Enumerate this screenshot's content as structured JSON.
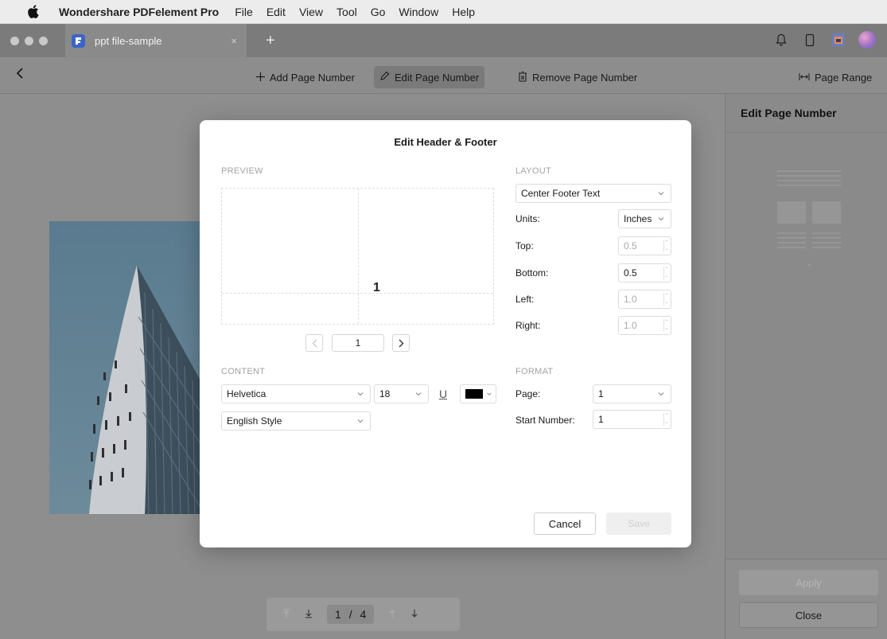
{
  "menubar": {
    "app_name": "Wondershare PDFelement Pro",
    "items": [
      "File",
      "Edit",
      "View",
      "Tool",
      "Go",
      "Window",
      "Help"
    ]
  },
  "tabbar": {
    "tab_title": "ppt file-sample",
    "close_glyph": "×",
    "add_glyph": "+"
  },
  "toolbar": {
    "add_page_number": "Add Page Number",
    "edit_page_number": "Edit Page Number",
    "remove_page_number": "Remove Page Number",
    "page_range": "Page Range"
  },
  "page_nav": {
    "current": "1",
    "separator": "/",
    "total": "4"
  },
  "right_panel": {
    "title": "Edit Page Number",
    "apply": "Apply",
    "close": "Close"
  },
  "dialog": {
    "title": "Edit Header & Footer",
    "preview_label": "PREVIEW",
    "preview_number": "1",
    "preview_page": "1",
    "content_label": "CONTENT",
    "font": "Helvetica",
    "font_size": "18",
    "underline_glyph": "U",
    "style": "English Style",
    "layout_label": "LAYOUT",
    "layout_position": "Center Footer Text",
    "units_label": "Units:",
    "units_value": "Inches",
    "top_label": "Top:",
    "top_value": "0.5",
    "bottom_label": "Bottom:",
    "bottom_value": "0.5",
    "left_label": "Left:",
    "left_value": "1.0",
    "right_label": "Right:",
    "right_value": "1.0",
    "format_label": "FORMAT",
    "page_label": "Page:",
    "page_value": "1",
    "start_number_label": "Start Number:",
    "start_number_value": "1",
    "cancel": "Cancel",
    "save": "Save"
  },
  "colors": {
    "text_color_swatch": "#000000",
    "brand_blue": "#3b63c9"
  }
}
